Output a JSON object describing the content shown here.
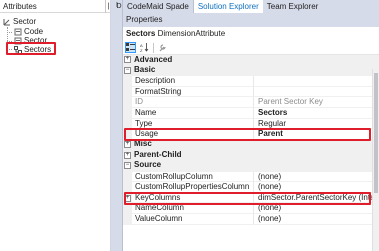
{
  "attributes_pane": {
    "title": "Attributes",
    "tree": [
      {
        "label": "Sector",
        "depth": 0,
        "icon": "dimension-icon"
      },
      {
        "label": "Code",
        "depth": 1,
        "icon": "attribute-icon"
      },
      {
        "label": "Sector",
        "depth": 1,
        "icon": "attribute-icon"
      },
      {
        "label": "Sectors",
        "depth": 1,
        "icon": "parent-child-attribute-icon",
        "selected": true
      }
    ]
  },
  "middle_strip": {
    "label_1": "I",
    "label_2": "D"
  },
  "tabs": [
    {
      "label": "CodeMaid Spade",
      "active": false
    },
    {
      "label": "Solution Explorer",
      "active": true
    },
    {
      "label": "Team Explorer",
      "active": false
    }
  ],
  "properties": {
    "title": "Properties",
    "object_name": "Sectors",
    "object_type": "DimensionAttribute",
    "rows": [
      {
        "kind": "category",
        "label": "Advanced",
        "expanded": false
      },
      {
        "kind": "category",
        "label": "Basic",
        "expanded": true
      },
      {
        "kind": "prop",
        "name": "Description",
        "value": ""
      },
      {
        "kind": "prop",
        "name": "FormatString",
        "value": ""
      },
      {
        "kind": "prop",
        "name": "ID",
        "value": "Parent Sector Key",
        "readonly": true
      },
      {
        "kind": "prop",
        "name": "Name",
        "value": "Sectors",
        "bold": true
      },
      {
        "kind": "prop",
        "name": "Type",
        "value": "Regular"
      },
      {
        "kind": "prop",
        "name": "Usage",
        "value": "Parent",
        "bold": true,
        "highlight": true
      },
      {
        "kind": "category",
        "label": "Misc",
        "expanded": false
      },
      {
        "kind": "category",
        "label": "Parent-Child",
        "expanded": false
      },
      {
        "kind": "category",
        "label": "Source",
        "expanded": true
      },
      {
        "kind": "prop",
        "name": "CustomRollupColumn",
        "value": "(none)"
      },
      {
        "kind": "prop",
        "name": "CustomRollupPropertiesColumn",
        "value": "(none)"
      },
      {
        "kind": "prop",
        "name": "KeyColumns",
        "value": "dimSector.ParentSectorKey (Integer)",
        "highlight": true,
        "expandable": true
      },
      {
        "kind": "prop",
        "name": "NameColumn",
        "value": "(none)"
      },
      {
        "kind": "prop",
        "name": "ValueColumn",
        "value": "(none)"
      }
    ]
  },
  "colors": {
    "highlight": "#e01e2b",
    "active_tab": "#0e70c0",
    "chrome": "#d6dbe9"
  }
}
